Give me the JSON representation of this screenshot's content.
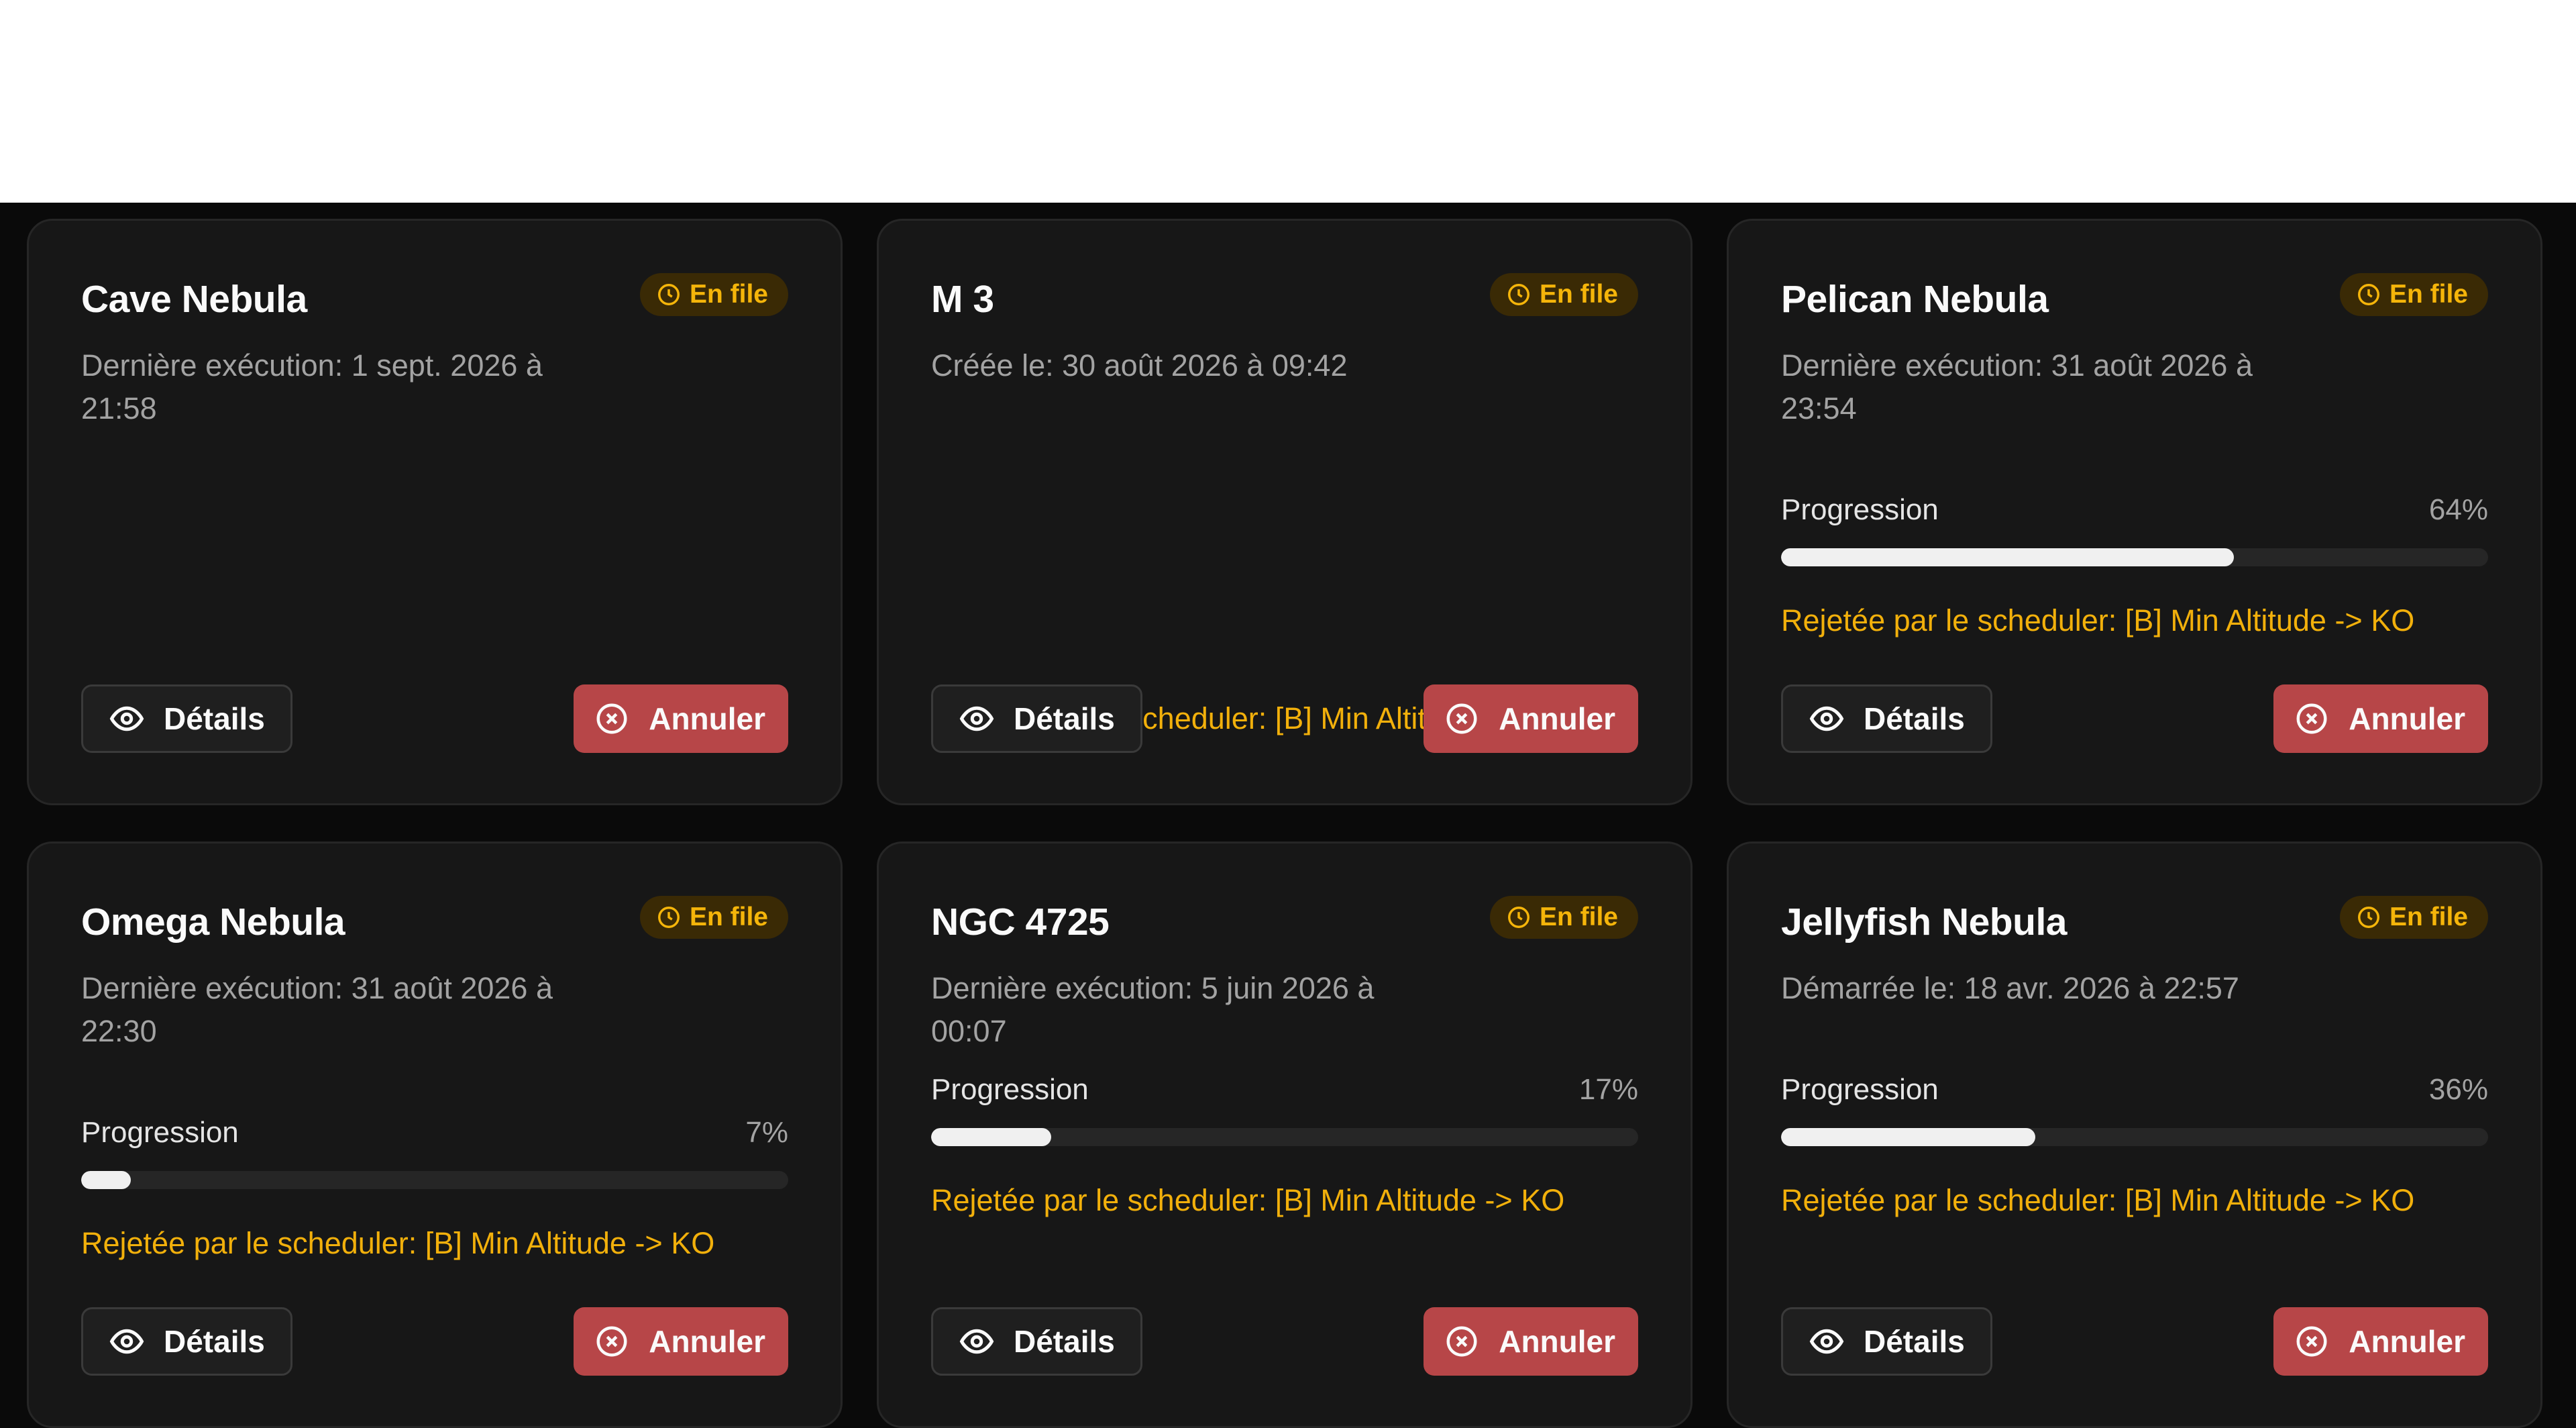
{
  "labels": {
    "status": "En file",
    "progress": "Progression",
    "details": "Détails",
    "cancel": "Annuler"
  },
  "colors": {
    "accent_warning": "#f2b00b",
    "cancel_button": "#b74648",
    "card_bg": "#171717"
  },
  "cards": [
    {
      "title": "Cave Nebula",
      "subtitle": "Dernière exécution: 1 sept. 2026 à 21:58",
      "progress": null,
      "progress_text": "",
      "warning": ""
    },
    {
      "title": "M 3",
      "subtitle": "Créée le: 30 août 2026 à 09:42",
      "progress": null,
      "progress_text": "",
      "warning": "Rejetée par le scheduler: [B] Min Altitude -> KO"
    },
    {
      "title": "Pelican Nebula",
      "subtitle": "Dernière exécution: 31 août 2026 à 23:54",
      "progress": 64,
      "progress_text": "64%",
      "warning": "Rejetée par le scheduler: [B] Min Altitude -> KO"
    },
    {
      "title": "Omega Nebula",
      "subtitle": "Dernière exécution: 31 août 2026 à 22:30",
      "progress": 7,
      "progress_text": "7%",
      "warning": "Rejetée par le scheduler: [B] Min Altitude -> KO"
    },
    {
      "title": "NGC 4725",
      "subtitle": "Dernière exécution: 5 juin 2026 à 00:07",
      "progress": 17,
      "progress_text": "17%",
      "warning": "Rejetée par le scheduler: [B] Min Altitude -> KO"
    },
    {
      "title": "Jellyfish Nebula",
      "subtitle": "Démarrée le: 18 avr. 2026 à 22:57",
      "progress": 36,
      "progress_text": "36%",
      "warning": "Rejetée par le scheduler: [B] Min Altitude -> KO"
    }
  ]
}
